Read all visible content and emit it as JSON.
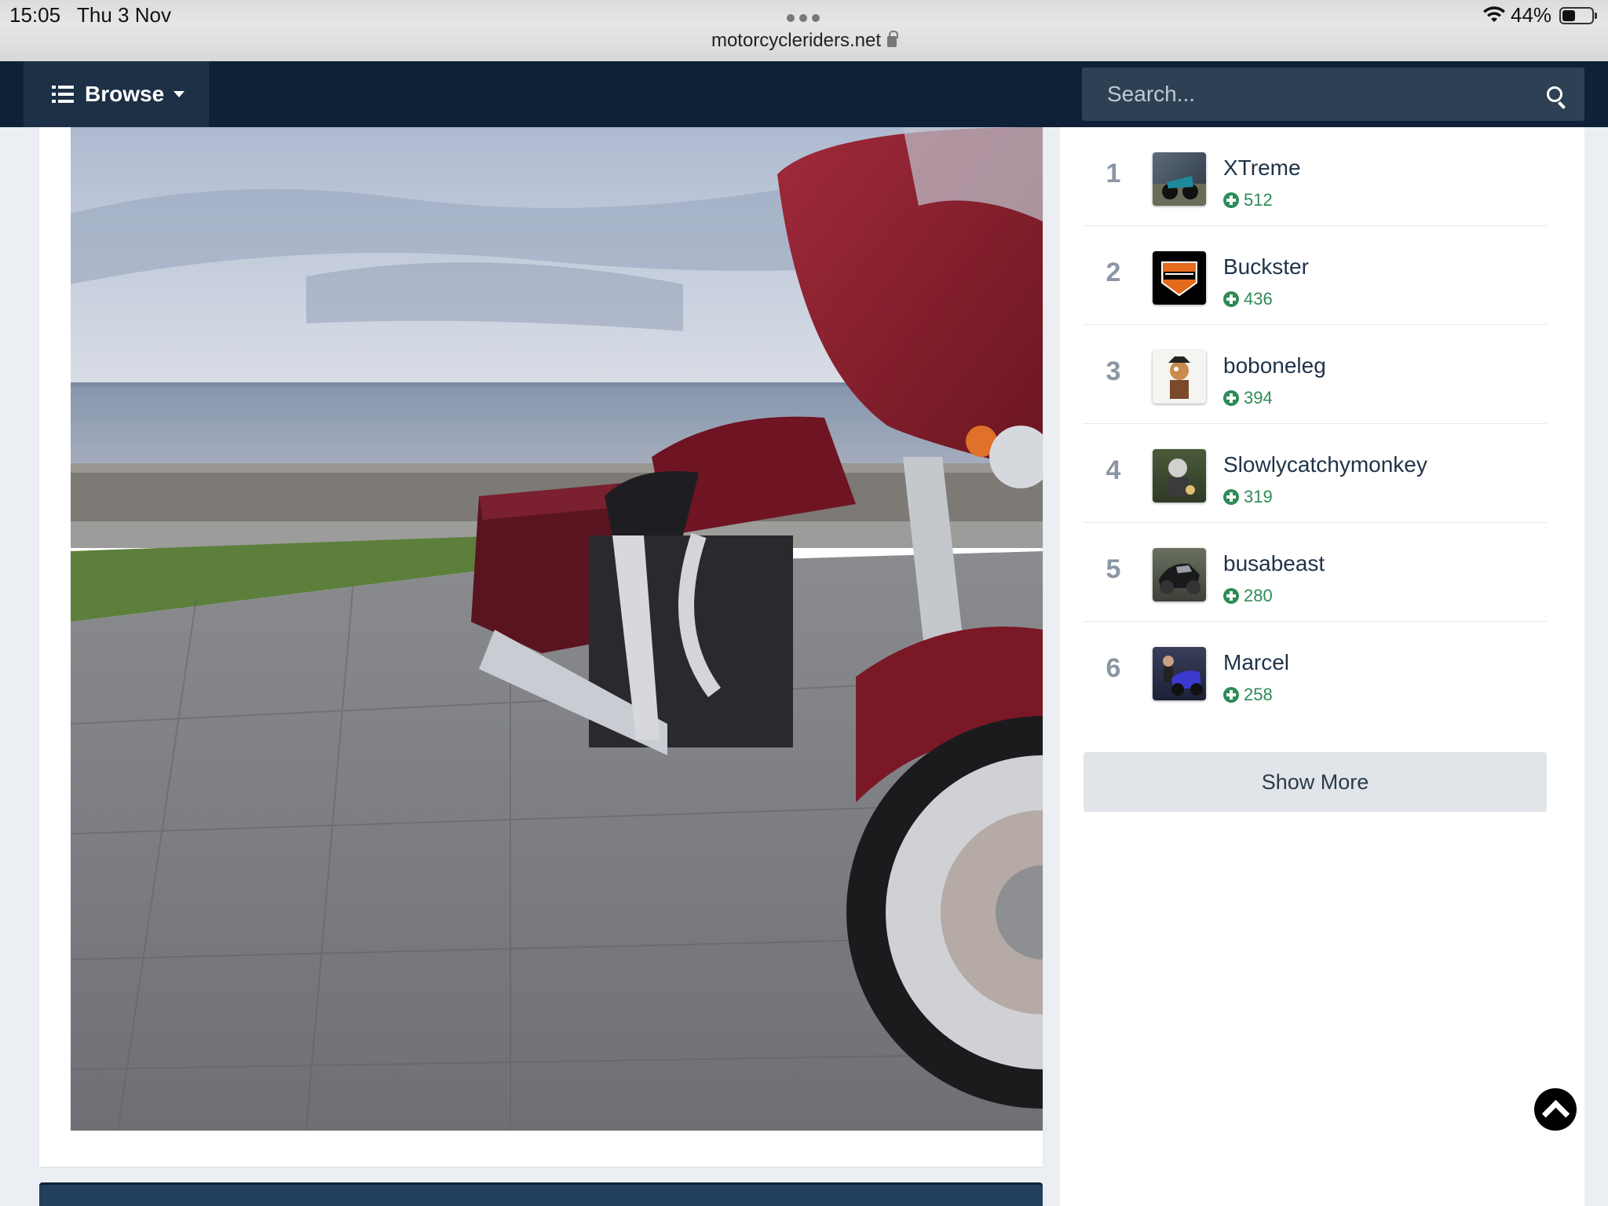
{
  "status": {
    "time": "15:05",
    "date": "Thu 3 Nov",
    "battery": "44%"
  },
  "browser": {
    "url": "motorcycleriders.net"
  },
  "nav": {
    "browse_label": "Browse",
    "search_placeholder": "Search..."
  },
  "leaderboard": {
    "items": [
      {
        "rank": "1",
        "name": "XTreme",
        "points": "512"
      },
      {
        "rank": "2",
        "name": "Buckster",
        "points": "436"
      },
      {
        "rank": "3",
        "name": "boboneleg",
        "points": "394"
      },
      {
        "rank": "4",
        "name": "Slowlycatchymonkey",
        "points": "319"
      },
      {
        "rank": "5",
        "name": "busabeast",
        "points": "280"
      },
      {
        "rank": "6",
        "name": "Marcel",
        "points": "258"
      }
    ],
    "show_more_label": "Show More"
  },
  "icons": {
    "menu": "list-icon",
    "dropdown": "caret-down-icon",
    "search": "search-icon",
    "reputation": "plus-circle-icon",
    "scroll_top": "arrow-up-icon",
    "lock": "lock-icon",
    "wifi": "wifi-icon",
    "battery": "battery-icon"
  },
  "colors": {
    "navbar": "#0e2137",
    "reputation": "#2e8b57",
    "accent_bar": "#22405e"
  }
}
